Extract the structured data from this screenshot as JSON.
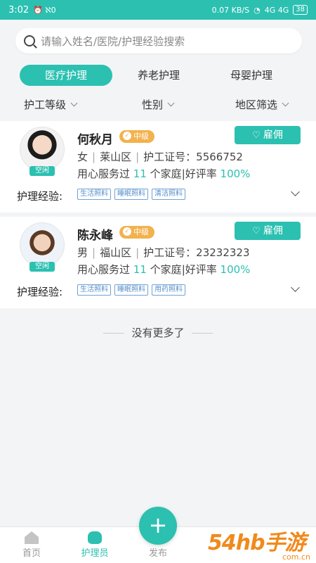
{
  "status_bar": {
    "time": "3:02",
    "left_extra": "⏰ ℵ0",
    "speed": "0.07",
    "speed_unit": "KB/S",
    "network": "4G 4G",
    "battery": "38"
  },
  "search": {
    "placeholder": "请输入姓名/医院/护理经验搜索"
  },
  "tabs": [
    "医疗护理",
    "养老护理",
    "母婴护理"
  ],
  "filters": {
    "level": "护工等级",
    "gender": "性别",
    "region": "地区筛选"
  },
  "caregivers": [
    {
      "name": "何秋月",
      "level": "中级",
      "status": "空闲",
      "hire_label": "雇佣",
      "gender": "女",
      "district": "莱山区",
      "cert_label": "护工证号：",
      "cert_no": "5566752",
      "service_prefix": "用心服务过",
      "families": "11",
      "service_suffix": "个家庭",
      "rating_label": "好评率",
      "rating": "100%",
      "exp_label": "护理经验:",
      "tags": [
        "生活照料",
        "睡眠照料",
        "清洁照料"
      ]
    },
    {
      "name": "陈永峰",
      "level": "中级",
      "status": "空闲",
      "hire_label": "雇佣",
      "gender": "男",
      "district": "福山区",
      "cert_label": "护工证号：",
      "cert_no": "23232323",
      "service_prefix": "用心服务过",
      "families": "11",
      "service_suffix": "个家庭",
      "rating_label": "好评率",
      "rating": "100%",
      "exp_label": "护理经验:",
      "tags": [
        "生活照料",
        "睡眠照料",
        "用药照料"
      ]
    }
  ],
  "no_more": "没有更多了",
  "tabbar": {
    "home": "首页",
    "nurse": "护理员",
    "publish": "发布",
    "fab": "+"
  },
  "watermark": {
    "main": "54hb手游网",
    "sub": "com.cn"
  },
  "colors": {
    "accent": "#2cc0b1",
    "level_badge": "#f2b24d",
    "tag_border": "#6fa3d6"
  }
}
